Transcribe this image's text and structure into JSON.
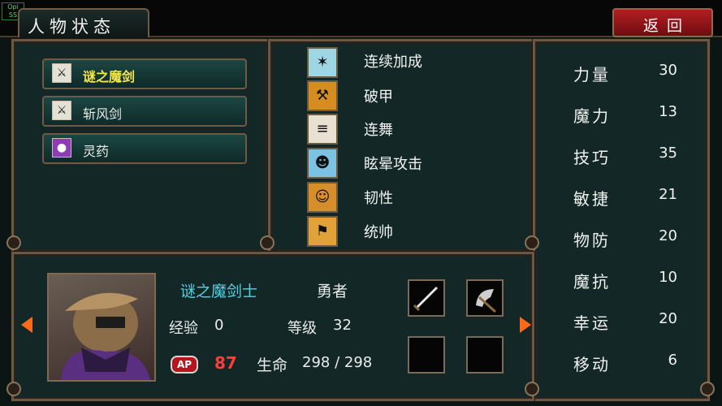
{
  "logo_text": "Opi\nSS",
  "header": {
    "title": "人物状态",
    "back_label": "返回"
  },
  "items": [
    {
      "label": "谜之魔剑",
      "icon": "sword-icon",
      "selected": true
    },
    {
      "label": "斩风剑",
      "icon": "sword-icon",
      "selected": false
    },
    {
      "label": "灵药",
      "icon": "potion-icon",
      "selected": false
    }
  ],
  "skills": [
    {
      "label": "连续加成",
      "icon": "burst-icon"
    },
    {
      "label": "破甲",
      "icon": "armor-break-icon"
    },
    {
      "label": "连舞",
      "icon": "blade-icon"
    },
    {
      "label": "眩晕攻击",
      "icon": "stun-icon"
    },
    {
      "label": "韧性",
      "icon": "toughness-icon"
    },
    {
      "label": "统帅",
      "icon": "command-icon"
    }
  ],
  "character": {
    "class_name": "谜之魔剑士",
    "title": "勇者",
    "exp_label": "经验",
    "exp_value": "0",
    "level_label": "等级",
    "level_value": "32",
    "ap_badge": "AP",
    "ap_value": "87",
    "hp_label": "生命",
    "hp_value": "298 / 298"
  },
  "stats": [
    {
      "label": "力量",
      "value": "30"
    },
    {
      "label": "魔力",
      "value": "13"
    },
    {
      "label": "技巧",
      "value": "35"
    },
    {
      "label": "敏捷",
      "value": "21"
    },
    {
      "label": "物防",
      "value": "20"
    },
    {
      "label": "魔抗",
      "value": "10"
    },
    {
      "label": "幸运",
      "value": "20"
    },
    {
      "label": "移动",
      "value": "6"
    }
  ],
  "colors": {
    "class_name": "#4fd3e6",
    "selected_item": "#f3e64a",
    "ap_value": "#ff3b3b",
    "back_button": "#b21e22"
  }
}
